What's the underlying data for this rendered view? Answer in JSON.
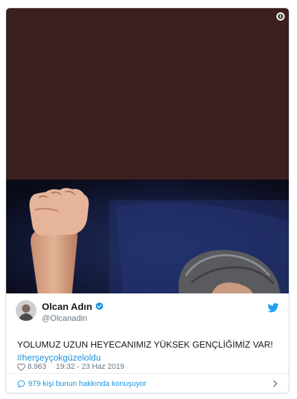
{
  "tweet": {
    "display_name": "Olcan Adın",
    "handle": "@Olcanadin",
    "text": "YOLUMUZ UZUN HEYECANIMIZ YÜKSEK GENÇLİĞİMİZ VAR!",
    "hashtag": "#herşeyçokgüzeloldu",
    "likes": "8.963",
    "timestamp": "19:32 - 23 Haz 2019",
    "conversation": "979 kişi bunun hakkında konuşuyor"
  },
  "icons": {
    "verified": "verified-badge-icon",
    "bird": "twitter-bird-icon",
    "heart": "heart-icon",
    "bubble": "reply-bubble-icon",
    "chevron": "chevron-right-icon",
    "info": "info-icon"
  },
  "colors": {
    "accent": "#1b95e0",
    "media_top": "#3c1f1f",
    "muted": "#657786",
    "border": "#ccd6dd"
  }
}
